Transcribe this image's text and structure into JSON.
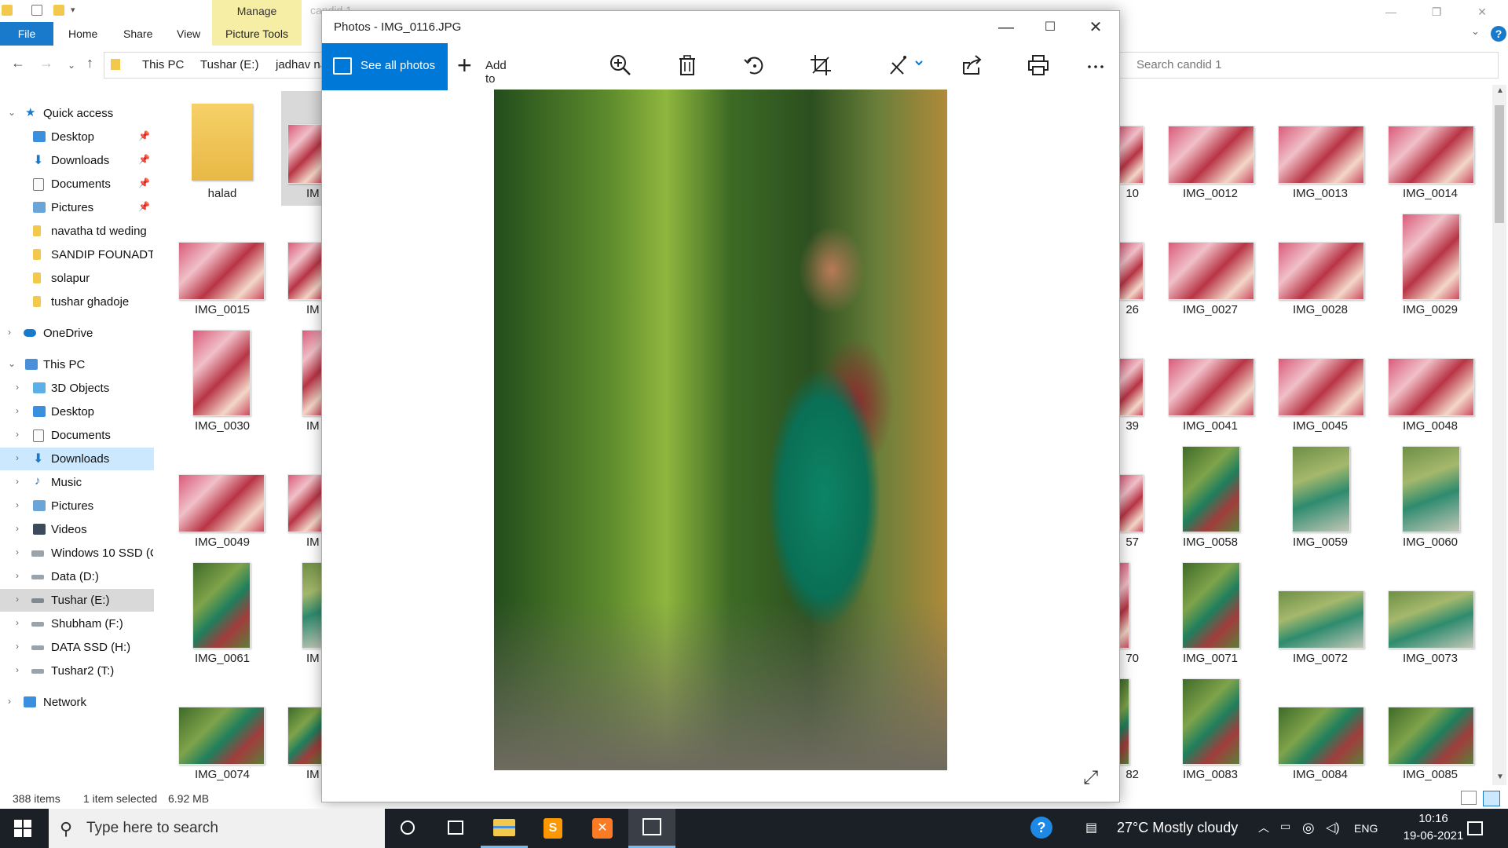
{
  "explorer": {
    "contextual_tab_group": "Manage",
    "ghost_title": "candid 1",
    "tabs": {
      "file": "File",
      "home": "Home",
      "share": "Share",
      "view": "View",
      "picture_tools": "Picture Tools"
    },
    "breadcrumbs": [
      "This PC",
      "Tushar (E:)",
      "jadhav na"
    ],
    "search_placeholder": "Search candid 1",
    "status": {
      "count": "388 items",
      "selected": "1 item selected",
      "size": "6.92 MB"
    }
  },
  "navpane": {
    "quick_access": "Quick access",
    "quick_items": [
      "Desktop",
      "Downloads",
      "Documents",
      "Pictures",
      "navatha td weding",
      "SANDIP FOUNADTI",
      "solapur",
      "tushar ghadoje"
    ],
    "onedrive": "OneDrive",
    "this_pc": "This PC",
    "pc_items": [
      "3D Objects",
      "Desktop",
      "Documents",
      "Downloads",
      "Music",
      "Pictures",
      "Videos",
      "Windows 10 SSD (C",
      "Data (D:)",
      "Tushar (E:)",
      "Shubham (F:)",
      "DATA SSD (H:)",
      "Tushar2 (T:)"
    ],
    "network": "Network"
  },
  "files": {
    "left_col1": [
      "halad",
      "IMG_0015",
      "IMG_0030",
      "IMG_0049",
      "IMG_0061",
      "IMG_0074"
    ],
    "left_col2": [
      "IM",
      "IM",
      "IM",
      "IM",
      "IM",
      "IM"
    ],
    "right_partial": [
      "10",
      "26",
      "39",
      "57",
      "70",
      "82"
    ],
    "right_col1": [
      "IMG_0012",
      "IMG_0027",
      "IMG_0041",
      "IMG_0058",
      "IMG_0071",
      "IMG_0083"
    ],
    "right_col2": [
      "IMG_0013",
      "IMG_0028",
      "IMG_0045",
      "IMG_0059",
      "IMG_0072",
      "IMG_0084"
    ],
    "right_col3": [
      "IMG_0014",
      "IMG_0029",
      "IMG_0048",
      "IMG_0060",
      "IMG_0073",
      "IMG_0085"
    ]
  },
  "photos": {
    "title": "Photos - IMG_0116.JPG",
    "see_all": "See all photos",
    "add_to": "Add to",
    "toolbar_icons": [
      "zoom-in-icon",
      "delete-icon",
      "rotate-icon",
      "crop-icon",
      "edit-icon",
      "share-icon",
      "print-icon",
      "more-icon"
    ]
  },
  "taskbar": {
    "search_placeholder": "Type here to search",
    "weather": "27°C  Mostly cloudy",
    "language": "ENG",
    "time": "10:16",
    "date": "19-06-2021"
  },
  "colors": {
    "accent": "#0078d7",
    "file_tab": "#1979ca",
    "manage_tab": "#f7eea6",
    "taskbar": "#1b1f26"
  }
}
